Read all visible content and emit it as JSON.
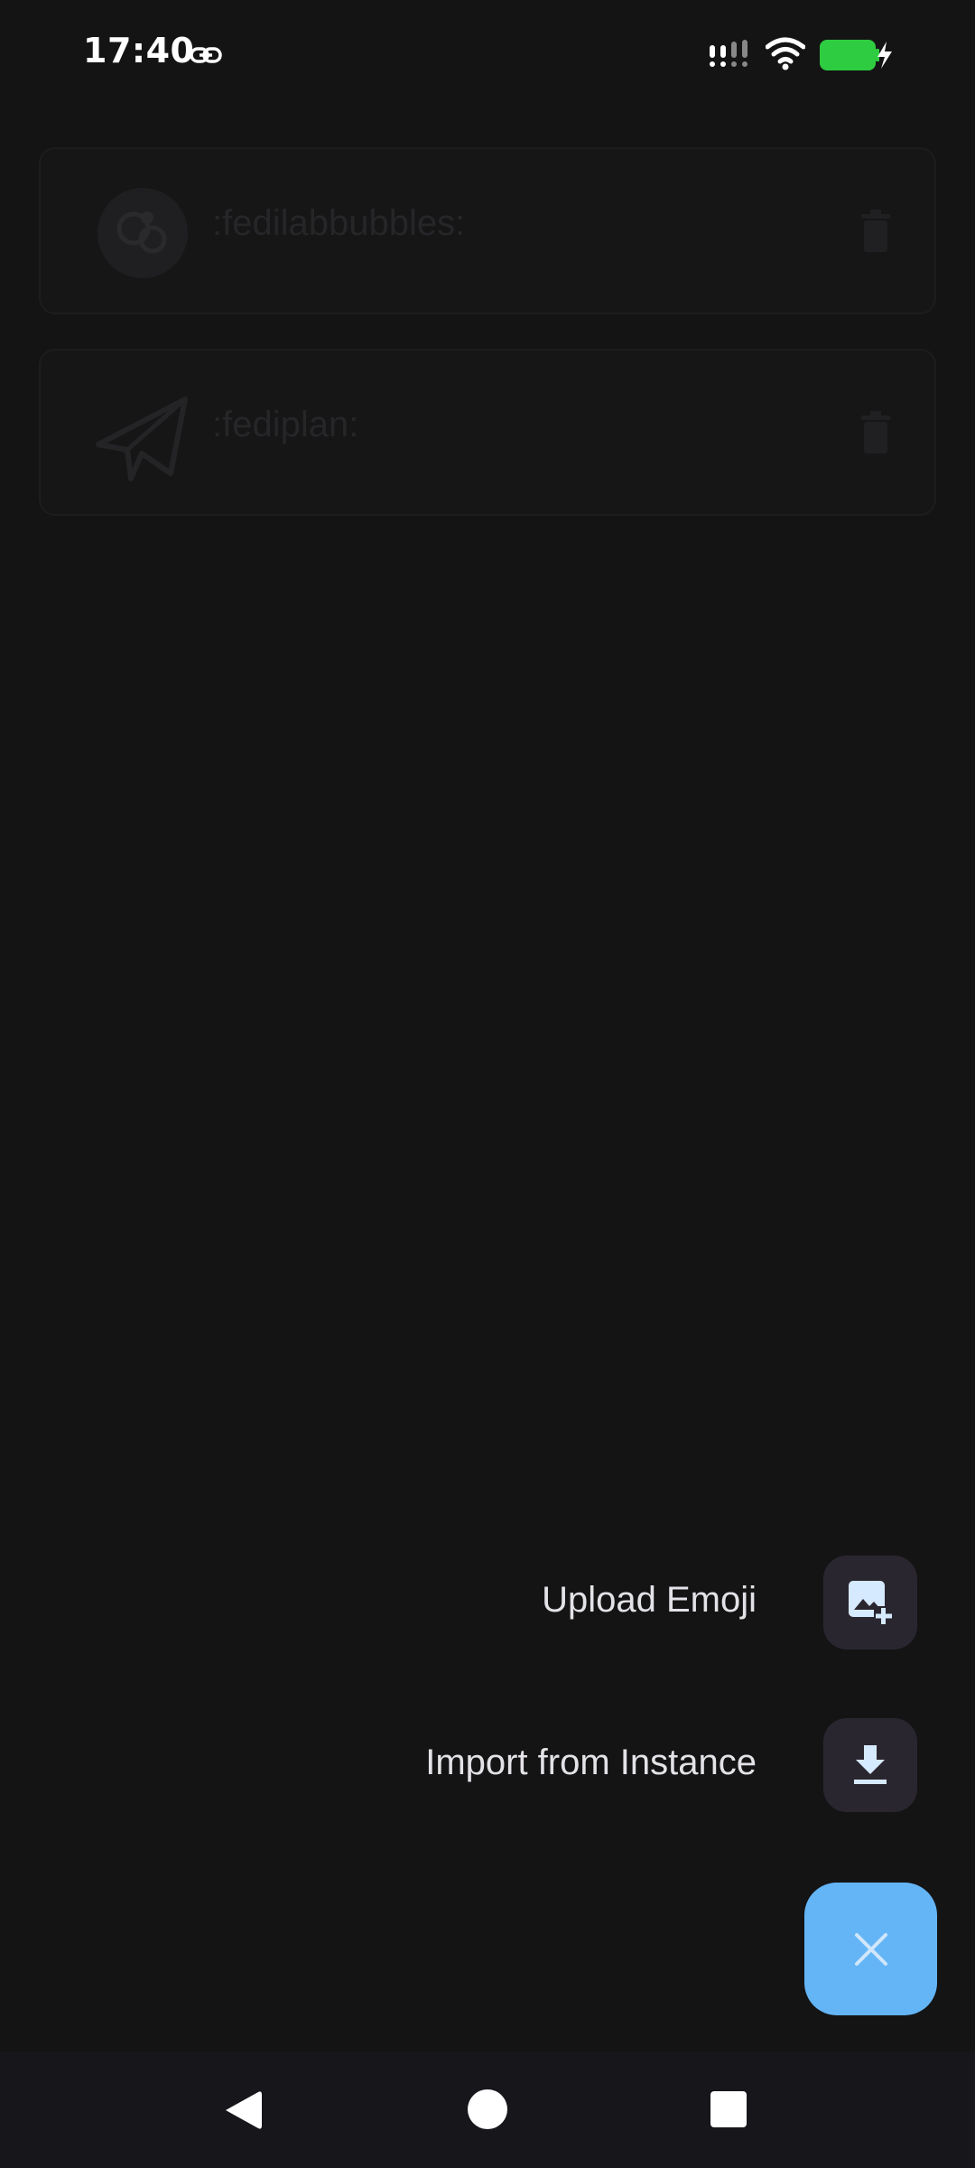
{
  "status_bar": {
    "time": "17:40",
    "icons": [
      "link-icon",
      "signal-icon",
      "wifi-icon",
      "battery-charging-icon"
    ],
    "battery_color": "#2ecc40"
  },
  "emojis": [
    {
      "shortcode": ":fedilabbubbles:",
      "icon": "fedilab-bubbles-logo"
    },
    {
      "shortcode": ":fediplan:",
      "icon": "paper-plane-icon"
    }
  ],
  "fab_menu": {
    "upload_label": "Upload Emoji",
    "upload_icon": "add-photo-icon",
    "import_label": "Import from Instance",
    "import_icon": "download-icon",
    "close_icon": "close-icon",
    "accent_color": "#64b5f6"
  },
  "nav_bar": {
    "icons": [
      "back-icon",
      "home-icon",
      "recents-icon"
    ]
  }
}
